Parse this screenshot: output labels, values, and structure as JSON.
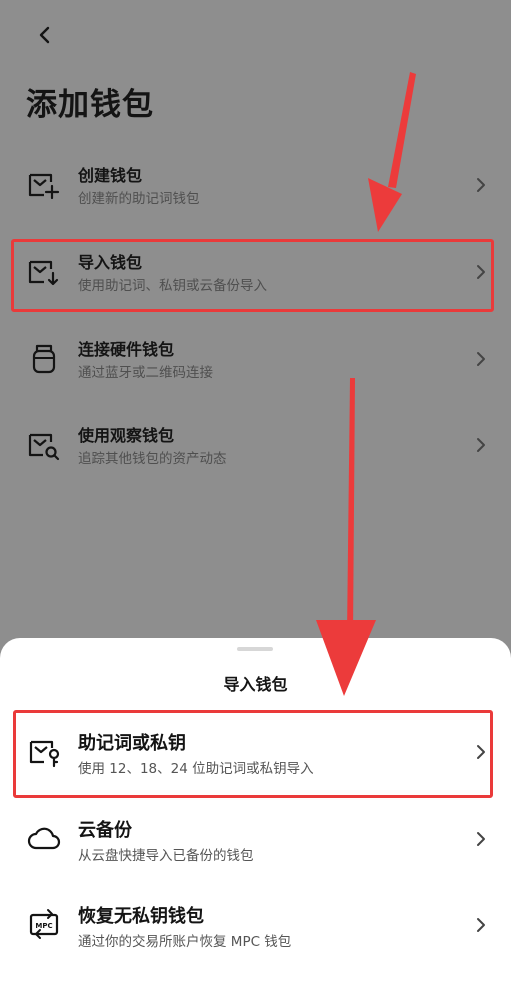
{
  "header": {
    "title": "添加钱包"
  },
  "wallet_options": [
    {
      "title": "创建钱包",
      "subtitle": "创建新的助记词钱包",
      "icon": "wallet-add-icon"
    },
    {
      "title": "导入钱包",
      "subtitle": "使用助记词、私钥或云备份导入",
      "icon": "wallet-import-icon"
    },
    {
      "title": "连接硬件钱包",
      "subtitle": "通过蓝牙或二维码连接",
      "icon": "hardware-wallet-icon"
    },
    {
      "title": "使用观察钱包",
      "subtitle": "追踪其他钱包的资产动态",
      "icon": "watch-wallet-icon"
    }
  ],
  "sheet": {
    "title": "导入钱包",
    "options": [
      {
        "title": "助记词或私钥",
        "subtitle": "使用 12、18、24 位助记词或私钥导入",
        "icon": "key-wallet-icon"
      },
      {
        "title": "云备份",
        "subtitle": "从云盘快捷导入已备份的钱包",
        "icon": "cloud-icon"
      },
      {
        "title": "恢复无私钥钱包",
        "subtitle": "通过你的交易所账户恢复 MPC 钱包",
        "icon": "mpc-icon"
      }
    ]
  },
  "colors": {
    "overlay": "#8e8e8e",
    "highlight": "#ea3a3a",
    "sheet": "#ffffff"
  }
}
